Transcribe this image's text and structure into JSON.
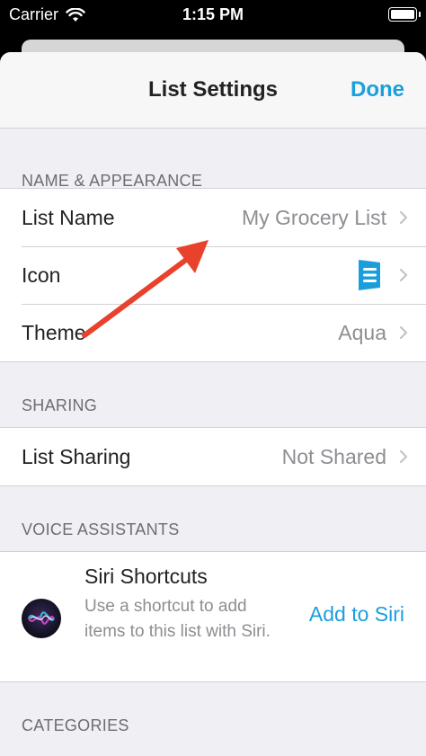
{
  "status_bar": {
    "carrier": "Carrier",
    "time": "1:15 PM"
  },
  "nav": {
    "title": "List Settings",
    "done_label": "Done"
  },
  "sections": {
    "name_appearance": {
      "header": "NAME & APPEARANCE",
      "list_name": {
        "label": "List Name",
        "value": "My Grocery List"
      },
      "icon": {
        "label": "Icon",
        "icon_name": "list-icon"
      },
      "theme": {
        "label": "Theme",
        "value": "Aqua"
      }
    },
    "sharing": {
      "header": "SHARING",
      "list_sharing": {
        "label": "List Sharing",
        "value": "Not Shared"
      }
    },
    "voice_assistants": {
      "header": "VOICE ASSISTANTS",
      "siri": {
        "title": "Siri Shortcuts",
        "description": "Use a shortcut to add items to this list with Siri.",
        "action_label": "Add to Siri"
      }
    },
    "categories": {
      "header": "CATEGORIES"
    }
  },
  "colors": {
    "accent": "#1a9fdc",
    "arrow": "#e8412c"
  }
}
